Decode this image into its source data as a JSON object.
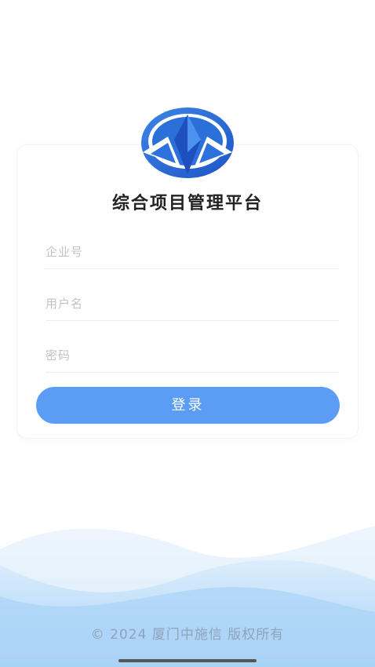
{
  "app": {
    "title": "综合项目管理平台",
    "logo_icon": "mountain-emblem-logo"
  },
  "form": {
    "company_placeholder": "企业号",
    "username_placeholder": "用户名",
    "password_placeholder": "密码",
    "company_value": "",
    "username_value": "",
    "password_value": "",
    "login_label": "登录"
  },
  "footer": {
    "copyright": "© 2024 厦门中施信 版权所有"
  },
  "colors": {
    "accent": "#5b9cf5",
    "logo_blue": "#2f6fd6",
    "wave_blue": "#9ccaf5"
  }
}
